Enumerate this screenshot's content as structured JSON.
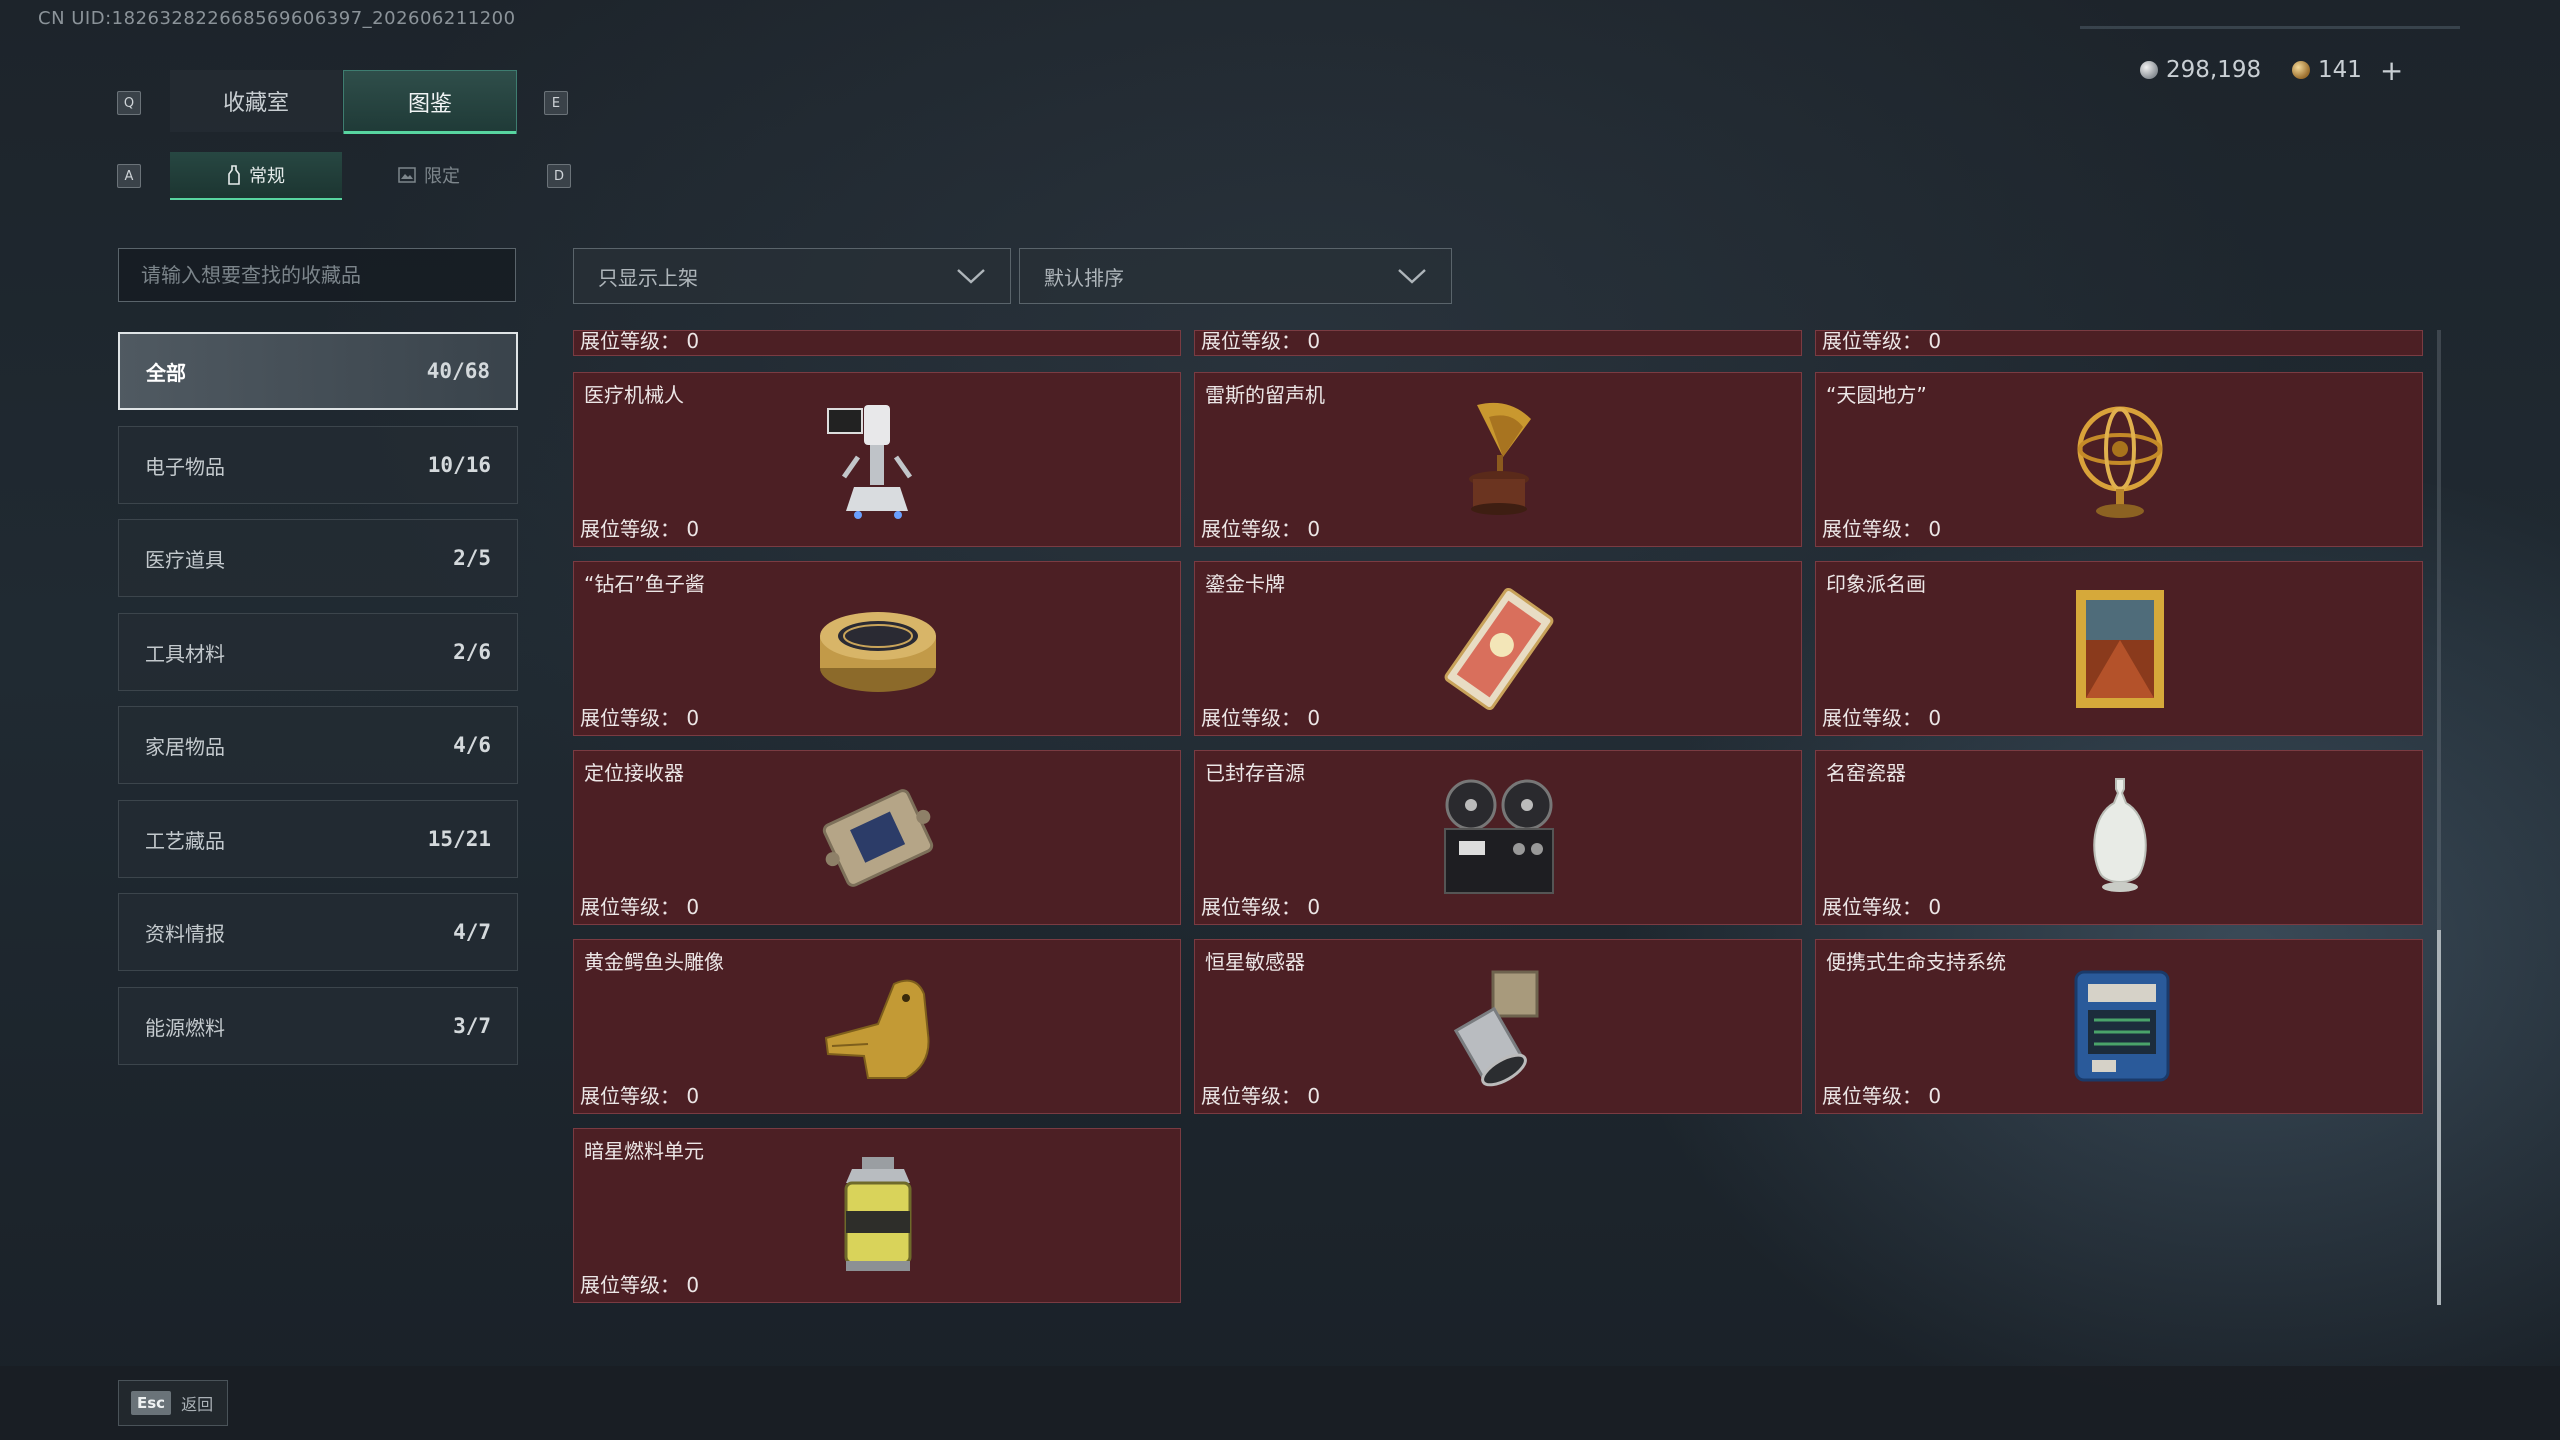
{
  "uid_text": "CN UID:18263282266856960639​7_202606211200",
  "currency": {
    "silver": "298,198",
    "gold": "141",
    "plus": "+"
  },
  "keys": {
    "q": "Q",
    "e": "E",
    "a": "A",
    "d": "D"
  },
  "tabs": [
    {
      "label": "收藏室"
    },
    {
      "label": "图鉴"
    }
  ],
  "subtabs": [
    {
      "label": "常规"
    },
    {
      "label": "限定"
    }
  ],
  "search": {
    "placeholder": "请输入想要查找的收藏品"
  },
  "filters": {
    "show_filter": "只显示上架",
    "sort": "默认排序"
  },
  "categories": [
    {
      "label": "全部",
      "count": "40/68"
    },
    {
      "label": "电子物品",
      "count": "10/16"
    },
    {
      "label": "医疗道具",
      "count": "2/5"
    },
    {
      "label": "工具材料",
      "count": "2/6"
    },
    {
      "label": "家居物品",
      "count": "4/6"
    },
    {
      "label": "工艺藏品",
      "count": "15/21"
    },
    {
      "label": "资料情报",
      "count": "4/7"
    },
    {
      "label": "能源燃料",
      "count": "3/7"
    }
  ],
  "level_label": "展位等级：",
  "level_value": "0",
  "partial_row": [
    {
      "level": "展位等级： 0"
    },
    {
      "level": "展位等级： 0"
    },
    {
      "level": "展位等级： 0"
    }
  ],
  "items": [
    {
      "name": "医疗机械人",
      "level": "展位等级： 0",
      "icon": "medical-robot-icon"
    },
    {
      "name": "雷斯的留声机",
      "level": "展位等级： 0",
      "icon": "gramophone-icon"
    },
    {
      "name": "“天圆地方”",
      "level": "展位等级： 0",
      "icon": "armillary-sphere-icon"
    },
    {
      "name": "“钻石”鱼子酱",
      "level": "展位等级： 0",
      "icon": "caviar-tin-icon"
    },
    {
      "name": "鎏金卡牌",
      "level": "展位等级： 0",
      "icon": "gilded-card-icon"
    },
    {
      "name": "印象派名画",
      "level": "展位等级： 0",
      "icon": "framed-painting-icon"
    },
    {
      "name": "定位接收器",
      "level": "展位等级： 0",
      "icon": "receiver-icon"
    },
    {
      "name": "已封存音源",
      "level": "展位等级： 0",
      "icon": "reel-recorder-icon"
    },
    {
      "name": "名窑瓷器",
      "level": "展位等级： 0",
      "icon": "porcelain-vase-icon"
    },
    {
      "name": "黄金鳄鱼头雕像",
      "level": "展位等级： 0",
      "icon": "gold-crocodile-icon"
    },
    {
      "name": "恒星敏感器",
      "level": "展位等级： 0",
      "icon": "star-sensor-icon"
    },
    {
      "name": "便携式生命支持系统",
      "level": "展位等级： 0",
      "icon": "life-support-icon"
    },
    {
      "name": "暗星燃料单元",
      "level": "展位等级： 0",
      "icon": "fuel-canister-icon"
    }
  ],
  "footer": {
    "esc_key": "Esc",
    "esc_label": "返回"
  }
}
